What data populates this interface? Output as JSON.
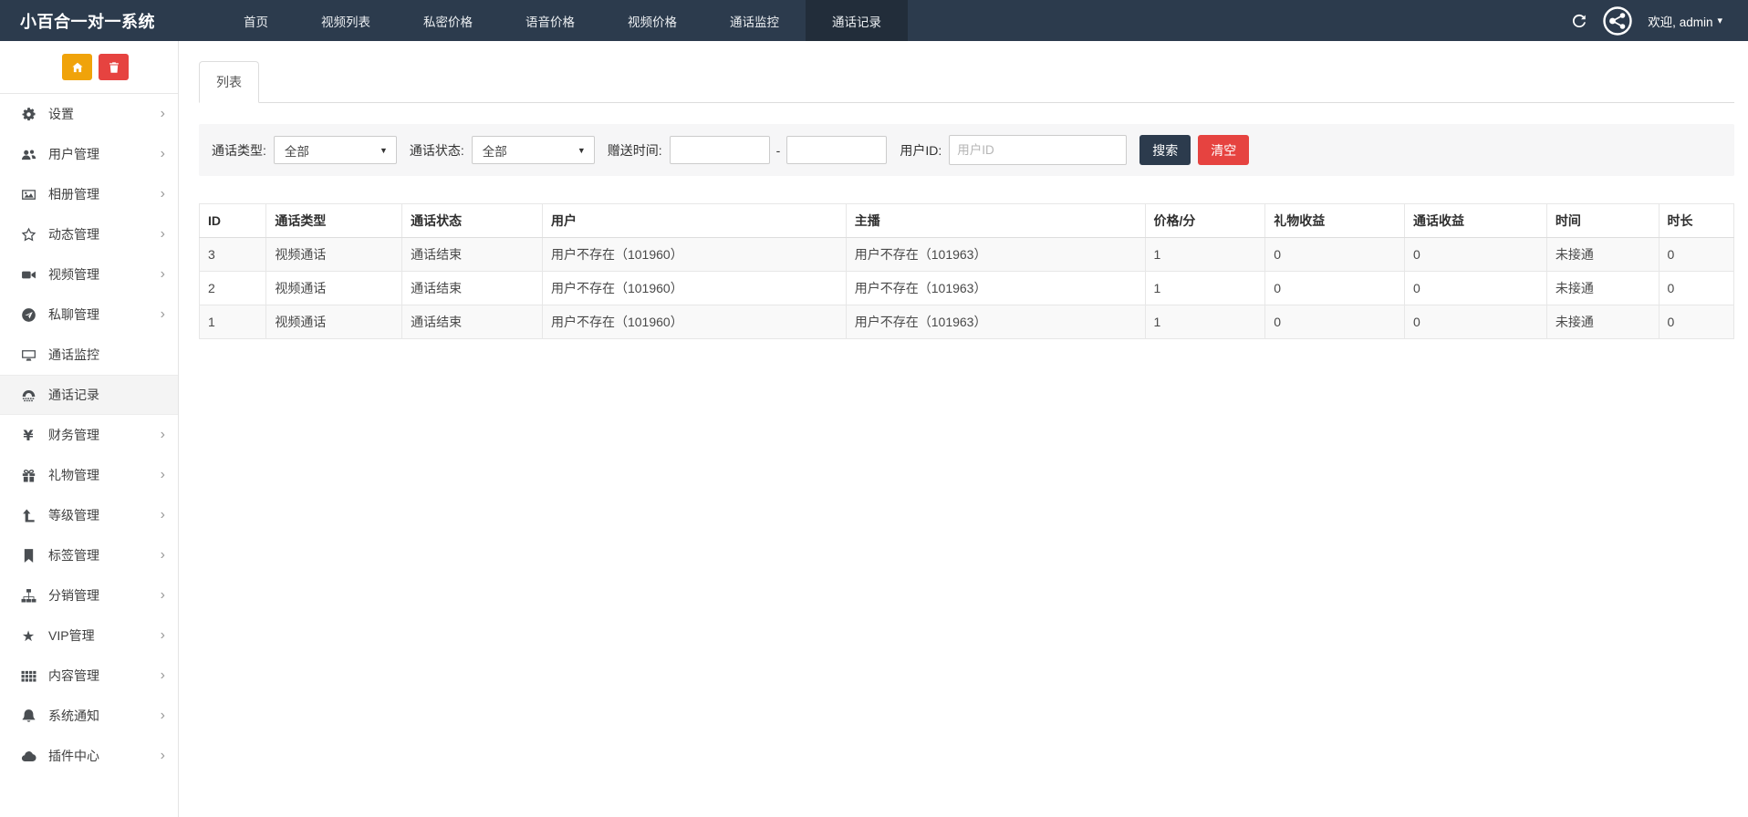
{
  "colors": {
    "navbar_bg": "#2c3b4d",
    "navbar_active_bg": "#222d3a",
    "sidebar_active_bg": "#f4f4f4",
    "home_button_bg": "#f0a30a",
    "trash_button_bg": "#e64340",
    "search_button_bg": "#2c3b4d",
    "clear_button_bg": "#e64340",
    "stripe_row_bg": "#f9f9f9"
  },
  "navbar": {
    "brand": "小百合一对一系统",
    "items": [
      {
        "label": "首页",
        "active": false
      },
      {
        "label": "视频列表",
        "active": false
      },
      {
        "label": "私密价格",
        "active": false
      },
      {
        "label": "语音价格",
        "active": false
      },
      {
        "label": "视频价格",
        "active": false
      },
      {
        "label": "通话监控",
        "active": false
      },
      {
        "label": "通话记录",
        "active": true
      }
    ],
    "refresh_icon": "refresh-icon",
    "avatar_icon": "share-network-avatar-icon",
    "welcome": "欢迎, admin",
    "caret_icon": "caret-down-icon"
  },
  "sidebar": {
    "action_icons": [
      "home-icon",
      "trash-icon"
    ],
    "items": [
      {
        "label": "设置",
        "icon": "gears-icon",
        "chevron": true,
        "active": false
      },
      {
        "label": "用户管理",
        "icon": "users-icon",
        "chevron": true,
        "active": false
      },
      {
        "label": "相册管理",
        "icon": "photo-icon",
        "chevron": true,
        "active": false
      },
      {
        "label": "动态管理",
        "icon": "star-outline-icon",
        "chevron": true,
        "active": false
      },
      {
        "label": "视频管理",
        "icon": "video-camera-icon",
        "chevron": true,
        "active": false
      },
      {
        "label": "私聊管理",
        "icon": "paper-plane-icon",
        "chevron": true,
        "active": false
      },
      {
        "label": "通话监控",
        "icon": "monitor-icon",
        "chevron": false,
        "active": false
      },
      {
        "label": "通话记录",
        "icon": "phone-icon",
        "chevron": false,
        "active": true
      },
      {
        "label": "财务管理",
        "icon": "yen-icon",
        "chevron": true,
        "active": false
      },
      {
        "label": "礼物管理",
        "icon": "gift-icon",
        "chevron": true,
        "active": false
      },
      {
        "label": "等级管理",
        "icon": "level-up-icon",
        "chevron": true,
        "active": false
      },
      {
        "label": "标签管理",
        "icon": "bookmark-icon",
        "chevron": true,
        "active": false
      },
      {
        "label": "分销管理",
        "icon": "sitemap-icon",
        "chevron": true,
        "active": false
      },
      {
        "label": "VIP管理",
        "icon": "star-icon",
        "chevron": true,
        "active": false
      },
      {
        "label": "内容管理",
        "icon": "grid-icon",
        "chevron": true,
        "active": false
      },
      {
        "label": "系统通知",
        "icon": "bell-icon",
        "chevron": true,
        "active": false
      },
      {
        "label": "插件中心",
        "icon": "cloud-icon",
        "chevron": true,
        "active": false
      }
    ]
  },
  "main": {
    "tab_label": "列表",
    "filters": {
      "call_type_label": "通话类型:",
      "call_type_value": "全部",
      "call_status_label": "通话状态:",
      "call_status_value": "全部",
      "gift_time_label": "赠送时间:",
      "range_separator": "-",
      "user_id_label": "用户ID:",
      "user_id_placeholder": "用户ID",
      "search_label": "搜索",
      "clear_label": "清空"
    },
    "table": {
      "headers": [
        "ID",
        "通话类型",
        "通话状态",
        "用户",
        "主播",
        "价格/分",
        "礼物收益",
        "通话收益",
        "时间",
        "时长"
      ],
      "rows": [
        [
          "3",
          "视频通话",
          "通话结束",
          "用户不存在（101960）",
          "用户不存在（101963）",
          "1",
          "0",
          "0",
          "未接通",
          "0"
        ],
        [
          "2",
          "视频通话",
          "通话结束",
          "用户不存在（101960）",
          "用户不存在（101963）",
          "1",
          "0",
          "0",
          "未接通",
          "0"
        ],
        [
          "1",
          "视频通话",
          "通话结束",
          "用户不存在（101960）",
          "用户不存在（101963）",
          "1",
          "0",
          "0",
          "未接通",
          "0"
        ]
      ]
    }
  }
}
